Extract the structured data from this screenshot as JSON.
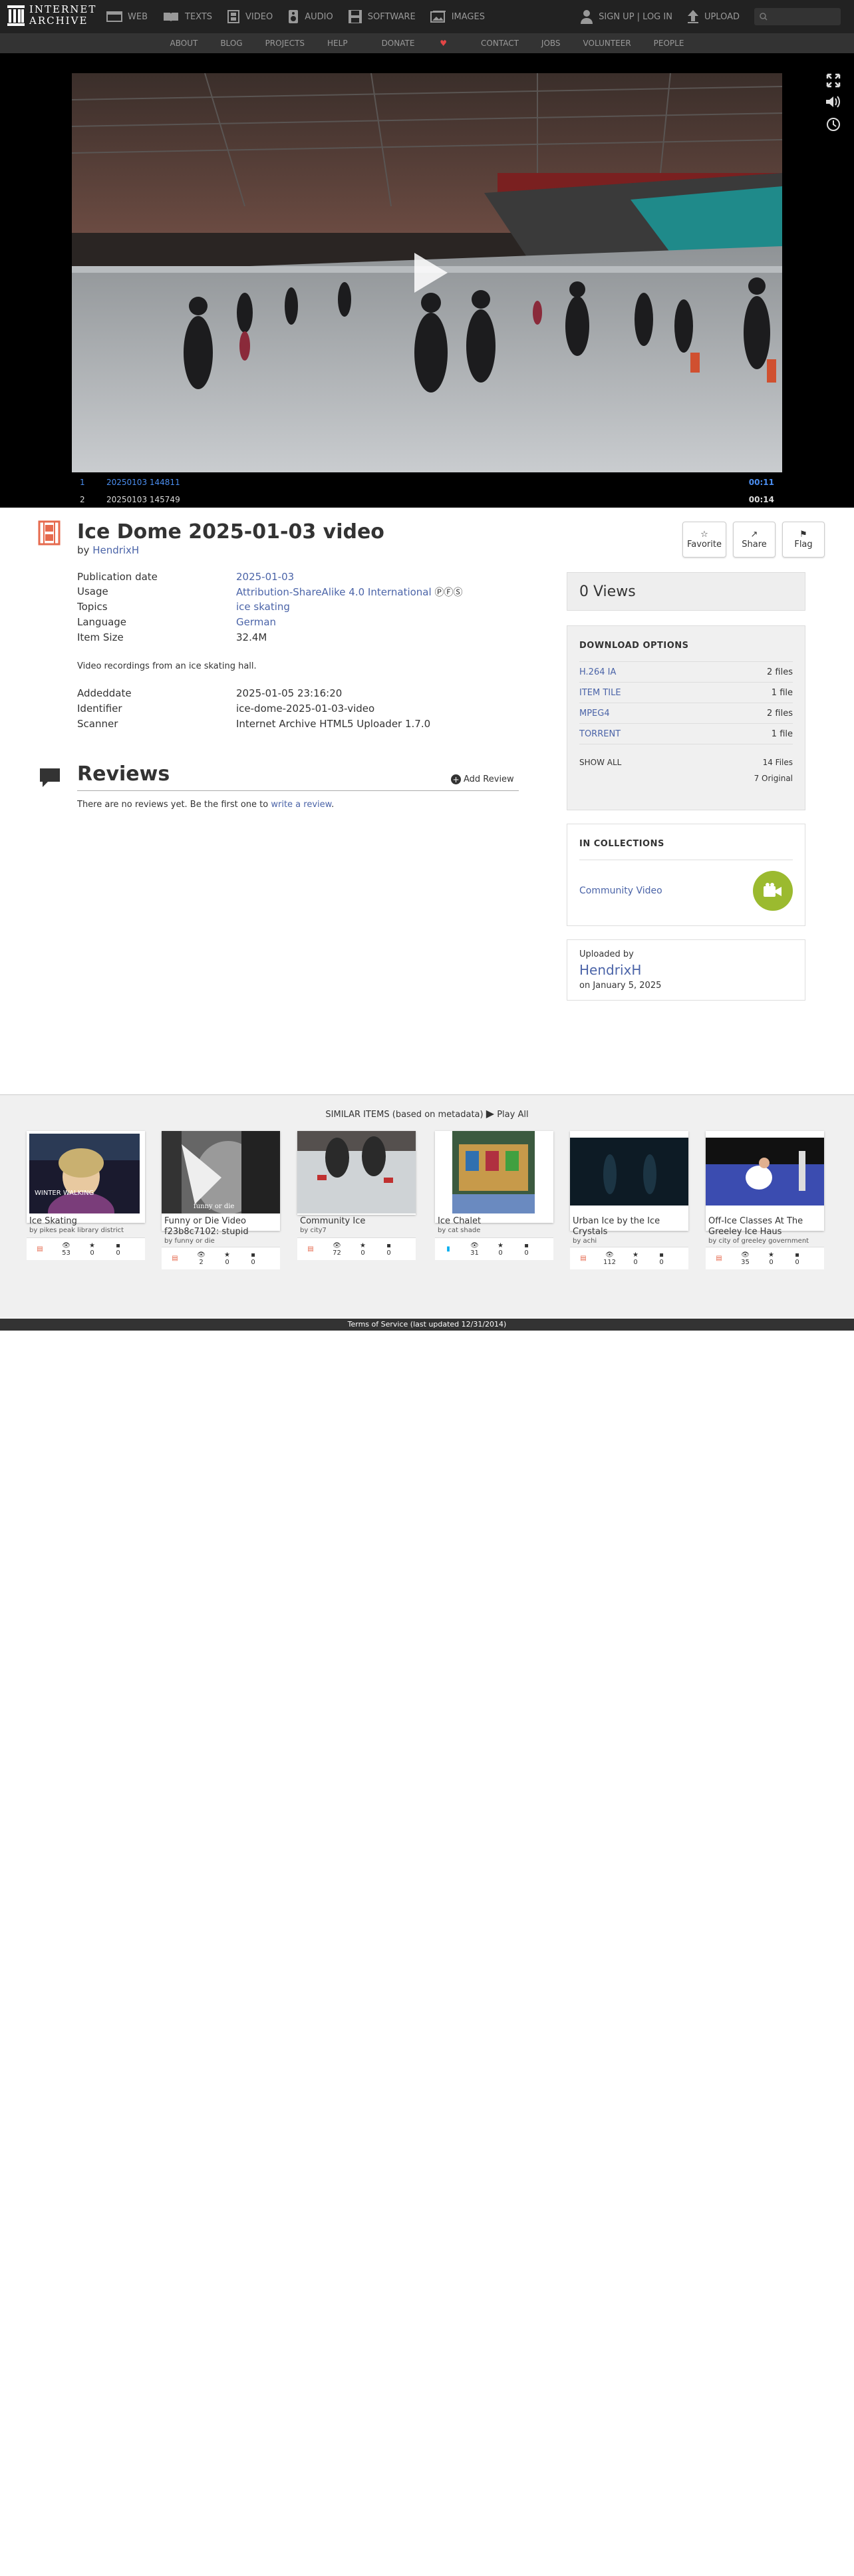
{
  "nav": {
    "logo_top": "INTERNET",
    "logo_bottom": "ARCHIVE",
    "items": [
      {
        "label": "WEB",
        "icon": "web-icon"
      },
      {
        "label": "TEXTS",
        "icon": "book-icon"
      },
      {
        "label": "VIDEO",
        "icon": "film-icon"
      },
      {
        "label": "AUDIO",
        "icon": "speaker-icon"
      },
      {
        "label": "SOFTWARE",
        "icon": "floppy-icon"
      },
      {
        "label": "IMAGES",
        "icon": "image-icon"
      }
    ],
    "signup": "SIGN UP | LOG IN",
    "upload": "UPLOAD",
    "search_icon": "search-icon"
  },
  "subnav": [
    "ABOUT",
    "BLOG",
    "PROJECTS",
    "HELP",
    "DONATE",
    "CONTACT",
    "JOBS",
    "VOLUNTEER",
    "PEOPLE"
  ],
  "player": {
    "playlist": [
      {
        "num": "1",
        "title": "20250103 144811",
        "duration": "00:11"
      },
      {
        "num": "2",
        "title": "20250103 145749",
        "duration": "00:14"
      }
    ]
  },
  "item": {
    "title": "Ice Dome 2025-01-03 video",
    "by": "by",
    "author": "HendrixH"
  },
  "actions": {
    "favorite": "Favorite",
    "share": "Share",
    "flag": "Flag"
  },
  "metadata": {
    "pubdate_label": "Publication date",
    "pubdate": "2025-01-03",
    "usage_label": "Usage",
    "usage": "Attribution-ShareAlike 4.0 International",
    "topics_label": "Topics",
    "topics": "ice skating",
    "language_label": "Language",
    "language": "German",
    "size_label": "Item Size",
    "size": "32.4M",
    "description": "Video recordings from an ice skating hall.",
    "adddate_label": "Addeddate",
    "adddate": "2025-01-05 23:16:20",
    "identifier_label": "Identifier",
    "identifier": "ice-dome-2025-01-03-video",
    "scanner_label": "Scanner",
    "scanner": "Internet Archive HTML5 Uploader 1.7.0"
  },
  "reviews": {
    "title": "Reviews",
    "add": "Add Review",
    "none_text": "There are no reviews yet. Be the first one to ",
    "none_link": "write a review",
    "none_end": "."
  },
  "views": "0 Views",
  "downloads": {
    "title": "DOWNLOAD OPTIONS",
    "rows": [
      {
        "label": "H.264 IA",
        "count": "2 files"
      },
      {
        "label": "ITEM TILE",
        "count": "1 file"
      },
      {
        "label": "MPEG4",
        "count": "2 files"
      },
      {
        "label": "TORRENT",
        "count": "1 file"
      }
    ],
    "show_all": "SHOW ALL",
    "total": "14 Files",
    "original": "7 Original"
  },
  "collections": {
    "title": "IN COLLECTIONS",
    "items": [
      "Community Video"
    ]
  },
  "uploader": {
    "label": "Uploaded by",
    "name": "HendrixH",
    "date": "on January 5, 2025"
  },
  "similar": {
    "heading": "SIMILAR ITEMS (based on metadata)",
    "play_all": "Play All",
    "cards": [
      {
        "title": "Ice Skating",
        "by": "by pikes peak library district",
        "views": "53",
        "favs": "0",
        "reviews": "0",
        "thumb_text": "WINTER WALKING",
        "type": "film"
      },
      {
        "title": "Funny or Die Video f23b8c7102: stupid",
        "by": "by funny or die",
        "views": "2",
        "favs": "0",
        "reviews": "0",
        "thumb_text": "funny or die",
        "type": "film"
      },
      {
        "title": "Community Ice",
        "by": "by city7",
        "views": "72",
        "favs": "0",
        "reviews": "0",
        "thumb_text": "",
        "type": "film"
      },
      {
        "title": "Ice Chalet",
        "by": "by cat shade",
        "views": "31",
        "favs": "0",
        "reviews": "0",
        "thumb_text": "",
        "type": "audio"
      },
      {
        "title": "Urban Ice by the Ice Crystals",
        "by": "by achi",
        "views": "112",
        "favs": "0",
        "reviews": "0",
        "thumb_text": "",
        "type": "film"
      },
      {
        "title": "Off-Ice Classes At The Greeley Ice Haus",
        "by": "by city of greeley government",
        "views": "35",
        "favs": "0",
        "reviews": "0",
        "thumb_text": "",
        "type": "film"
      }
    ]
  },
  "footer": "Terms of Service (last updated 12/31/2014)",
  "colors": {
    "accent": "#4b64a8",
    "film": "#e66a4e",
    "audio": "#00adef",
    "collection": "#9bba2f"
  }
}
